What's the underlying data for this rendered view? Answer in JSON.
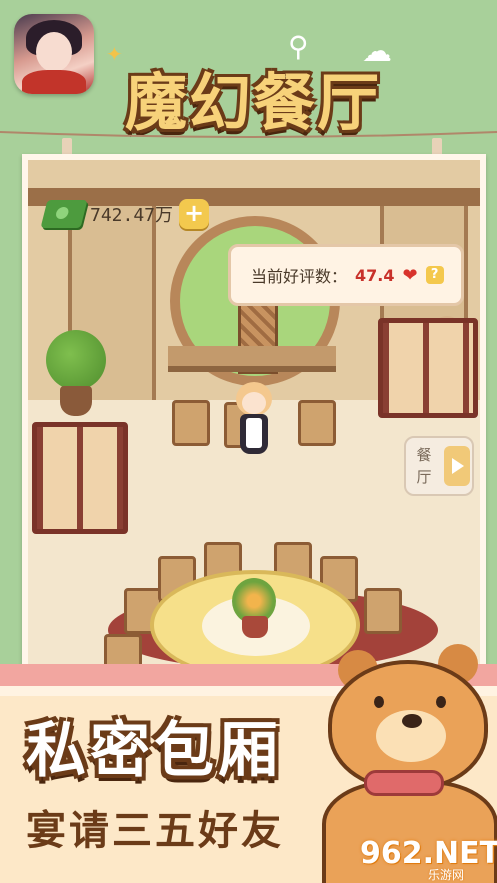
{
  "header": {
    "game_title": "魔幻餐厅"
  },
  "hud": {
    "money_value": "742.47万",
    "plus_label": "+",
    "rating_label": "当前好评数：",
    "rating_value": "47.4",
    "help_label": "?"
  },
  "side_tab": {
    "label_line1": "餐",
    "label_line2": "厅"
  },
  "banner": {
    "slogan_main": "私密包厢",
    "slogan_sub": "宴请三五好友"
  },
  "watermark": {
    "main": "962.NET",
    "sub": "乐游网"
  },
  "colors": {
    "background": "#a8d09a",
    "title_gold": "#f7d27a",
    "outline_brown": "#6b3b18",
    "rating_red": "#c8312a",
    "banner_pink": "#f2a6a0"
  },
  "icons": {
    "money": "money-stack-icon",
    "plus": "plus-icon",
    "heart": "heart-icon",
    "help": "question-icon",
    "arrow": "arrow-right-icon",
    "flower": "flower-icon"
  }
}
